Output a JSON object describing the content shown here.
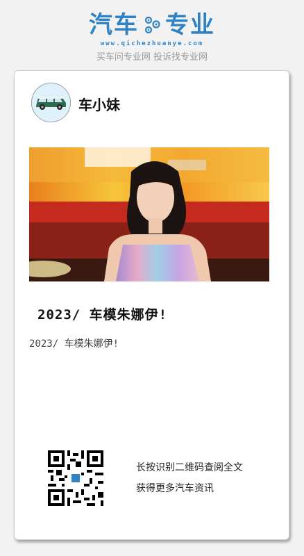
{
  "header": {
    "logo_left": "汽车",
    "logo_right": "专业",
    "logo_icon": "gear-icon",
    "url": "www.qichezhuanye.com",
    "slogan": "买车问专业网 投诉找专业网"
  },
  "card": {
    "author": "车小妹",
    "avatar_icon": "car-icon",
    "title": "2023/ 车模朱娜伊!",
    "description": "2023/ 车模朱娜伊!",
    "qr_line1": "长按识别二维码查阅全文",
    "qr_line2": "获得更多汽车资讯",
    "qr_icon": "qr-code-icon"
  },
  "colors": {
    "brand": "#2f82c4",
    "slogan": "#9a9a9a"
  }
}
